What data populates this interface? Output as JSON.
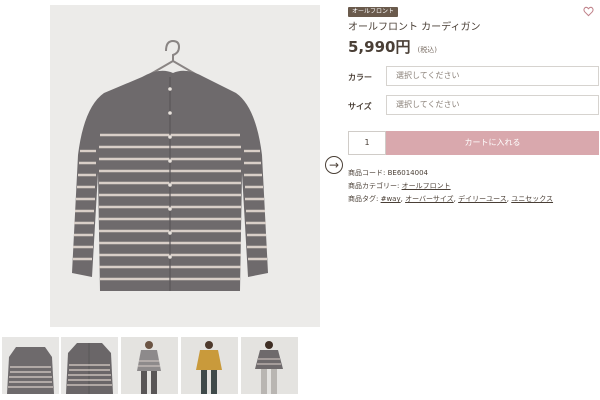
{
  "product": {
    "badge": "オールフロント",
    "title": "オールフロント カーディガン",
    "price": "5,990円",
    "tax_note": "(税込)"
  },
  "options": [
    {
      "label": "カラー",
      "placeholder": "選択してください"
    },
    {
      "label": "サイズ",
      "placeholder": "選択してください"
    }
  ],
  "cart": {
    "quantity": "1",
    "add_to_cart_label": "カートに入れる"
  },
  "meta": {
    "code_label": "商品コード:",
    "code_value": "BE6014004",
    "category_label": "商品カテゴリー:",
    "category_value": "オールフロント",
    "tags_label": "商品タグ:",
    "tags": [
      "#way",
      "オーバーサイズ",
      "デイリーユース",
      "ユニセックス"
    ]
  },
  "icons": {
    "favorite": "heart-icon",
    "next": "arrow-right-icon",
    "hanger": "hanger-icon"
  },
  "colors": {
    "accent_button": "#d9a8ad",
    "badge_bg": "#6a5a4c",
    "text": "#4a3f36",
    "garment": "#6e6a6c",
    "stripe": "#d9cfc8"
  }
}
